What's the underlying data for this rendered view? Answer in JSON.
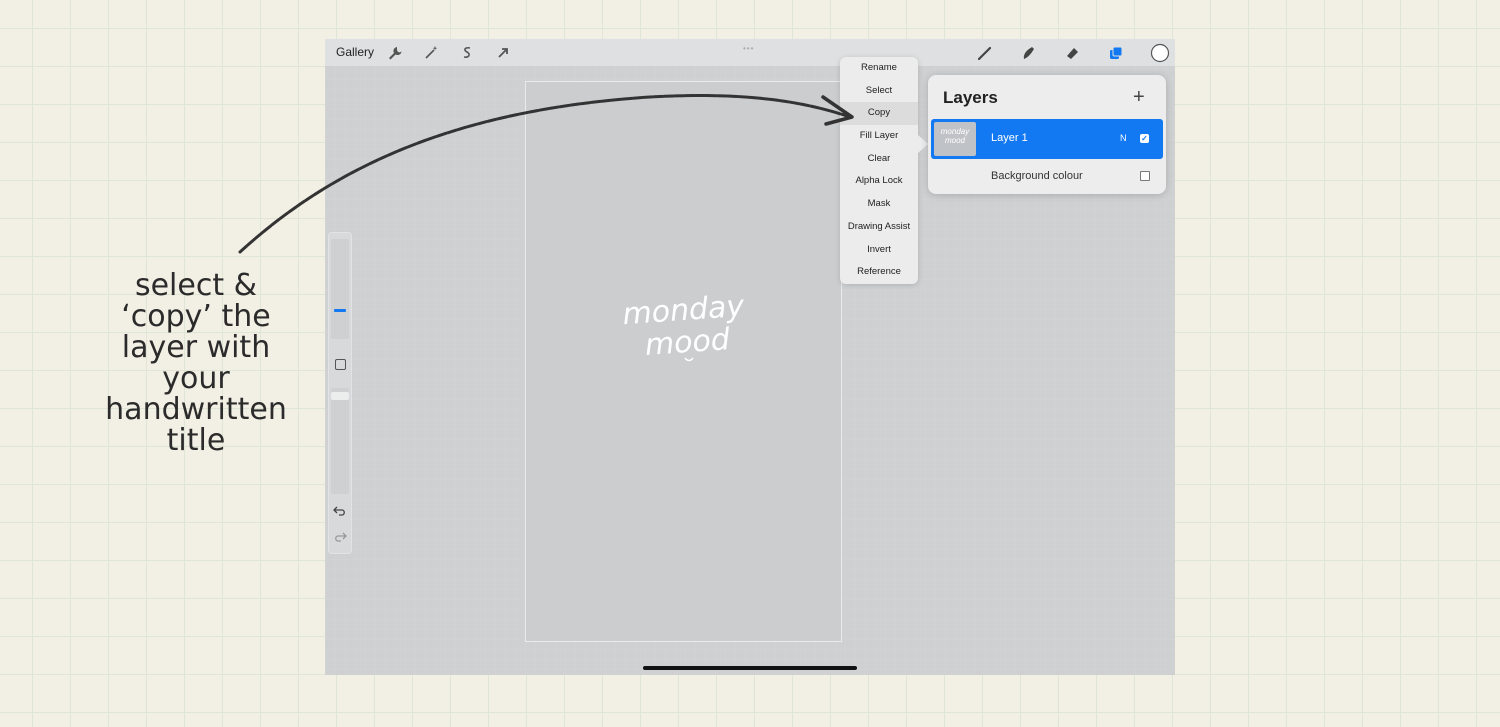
{
  "caption": {
    "lines": [
      "select &",
      "‘copy’ the",
      "layer with",
      "your",
      "handwritten",
      "title"
    ]
  },
  "toolbar": {
    "gallery_label": "Gallery",
    "left_icons": [
      "wrench-icon",
      "magic-wand-icon",
      "selection-s-icon",
      "transform-arrow-icon"
    ],
    "right_icons": [
      "brush-icon",
      "smudge-icon",
      "eraser-icon",
      "layers-icon",
      "color-circle-icon"
    ]
  },
  "canvas": {
    "handwriting_line1": "monday",
    "handwriting_line2": "mood"
  },
  "layer_menu": {
    "items": [
      "Rename",
      "Select",
      "Copy",
      "Fill Layer",
      "Clear",
      "Alpha Lock",
      "Mask",
      "Drawing Assist",
      "Invert",
      "Reference"
    ],
    "highlighted": "Copy"
  },
  "layers_panel": {
    "title": "Layers",
    "add_symbol": "+",
    "layer": {
      "name": "Layer 1",
      "blend_mode": "N",
      "visible": true,
      "thumbnail_text_1": "monday",
      "thumbnail_text_2": "mood"
    },
    "background": {
      "name": "Background colour",
      "visible": false
    }
  },
  "colors": {
    "page_background": "#f2efe4",
    "ipad_canvas": "#ced0d2",
    "accent_blue": "#1279f2",
    "annotation_ink": "#333333"
  }
}
